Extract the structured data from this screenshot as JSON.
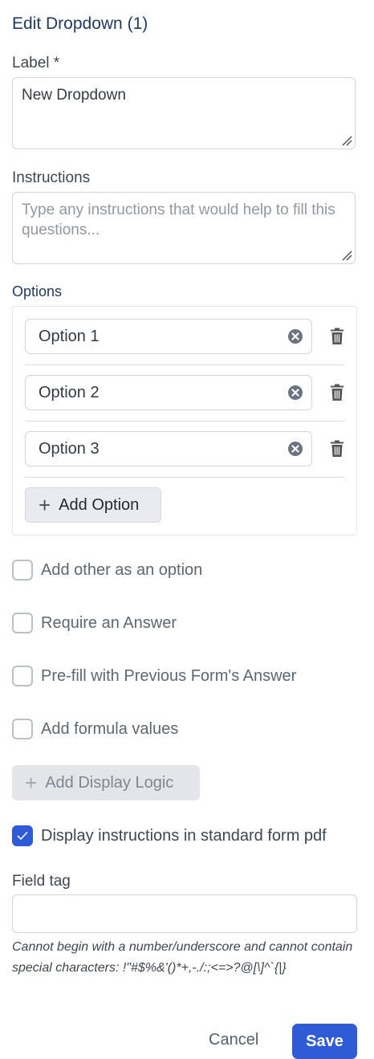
{
  "header": {
    "title": "Edit Dropdown (1)"
  },
  "label_field": {
    "label": "Label *",
    "value": "New Dropdown"
  },
  "instructions_field": {
    "label": "Instructions",
    "placeholder": "Type any instructions that would help to fill this questions..."
  },
  "options": {
    "label": "Options",
    "items": [
      {
        "value": "Option 1"
      },
      {
        "value": "Option 2"
      },
      {
        "value": "Option 3"
      }
    ],
    "add_label": "Add Option"
  },
  "checkboxes": [
    {
      "label": "Add other as an option",
      "checked": false
    },
    {
      "label": "Require an Answer",
      "checked": false
    },
    {
      "label": "Pre-fill with Previous Form's Answer",
      "checked": false
    },
    {
      "label": "Add formula values",
      "checked": false
    }
  ],
  "display_logic": {
    "label": "Add Display Logic",
    "disabled": true
  },
  "pdf_checkbox": {
    "label": "Display instructions in standard form pdf",
    "checked": true
  },
  "field_tag": {
    "label": "Field tag",
    "value": "",
    "help": "Cannot begin with a number/underscore and cannot contain special characters: !\"#$%&'()*+,-./:;<=>?@[\\]^`{|}"
  },
  "footer": {
    "cancel_label": "Cancel",
    "save_label": "Save"
  },
  "colors": {
    "primary": "#2f5bd6",
    "title": "#1f3b63",
    "border": "#cfd5dc"
  }
}
